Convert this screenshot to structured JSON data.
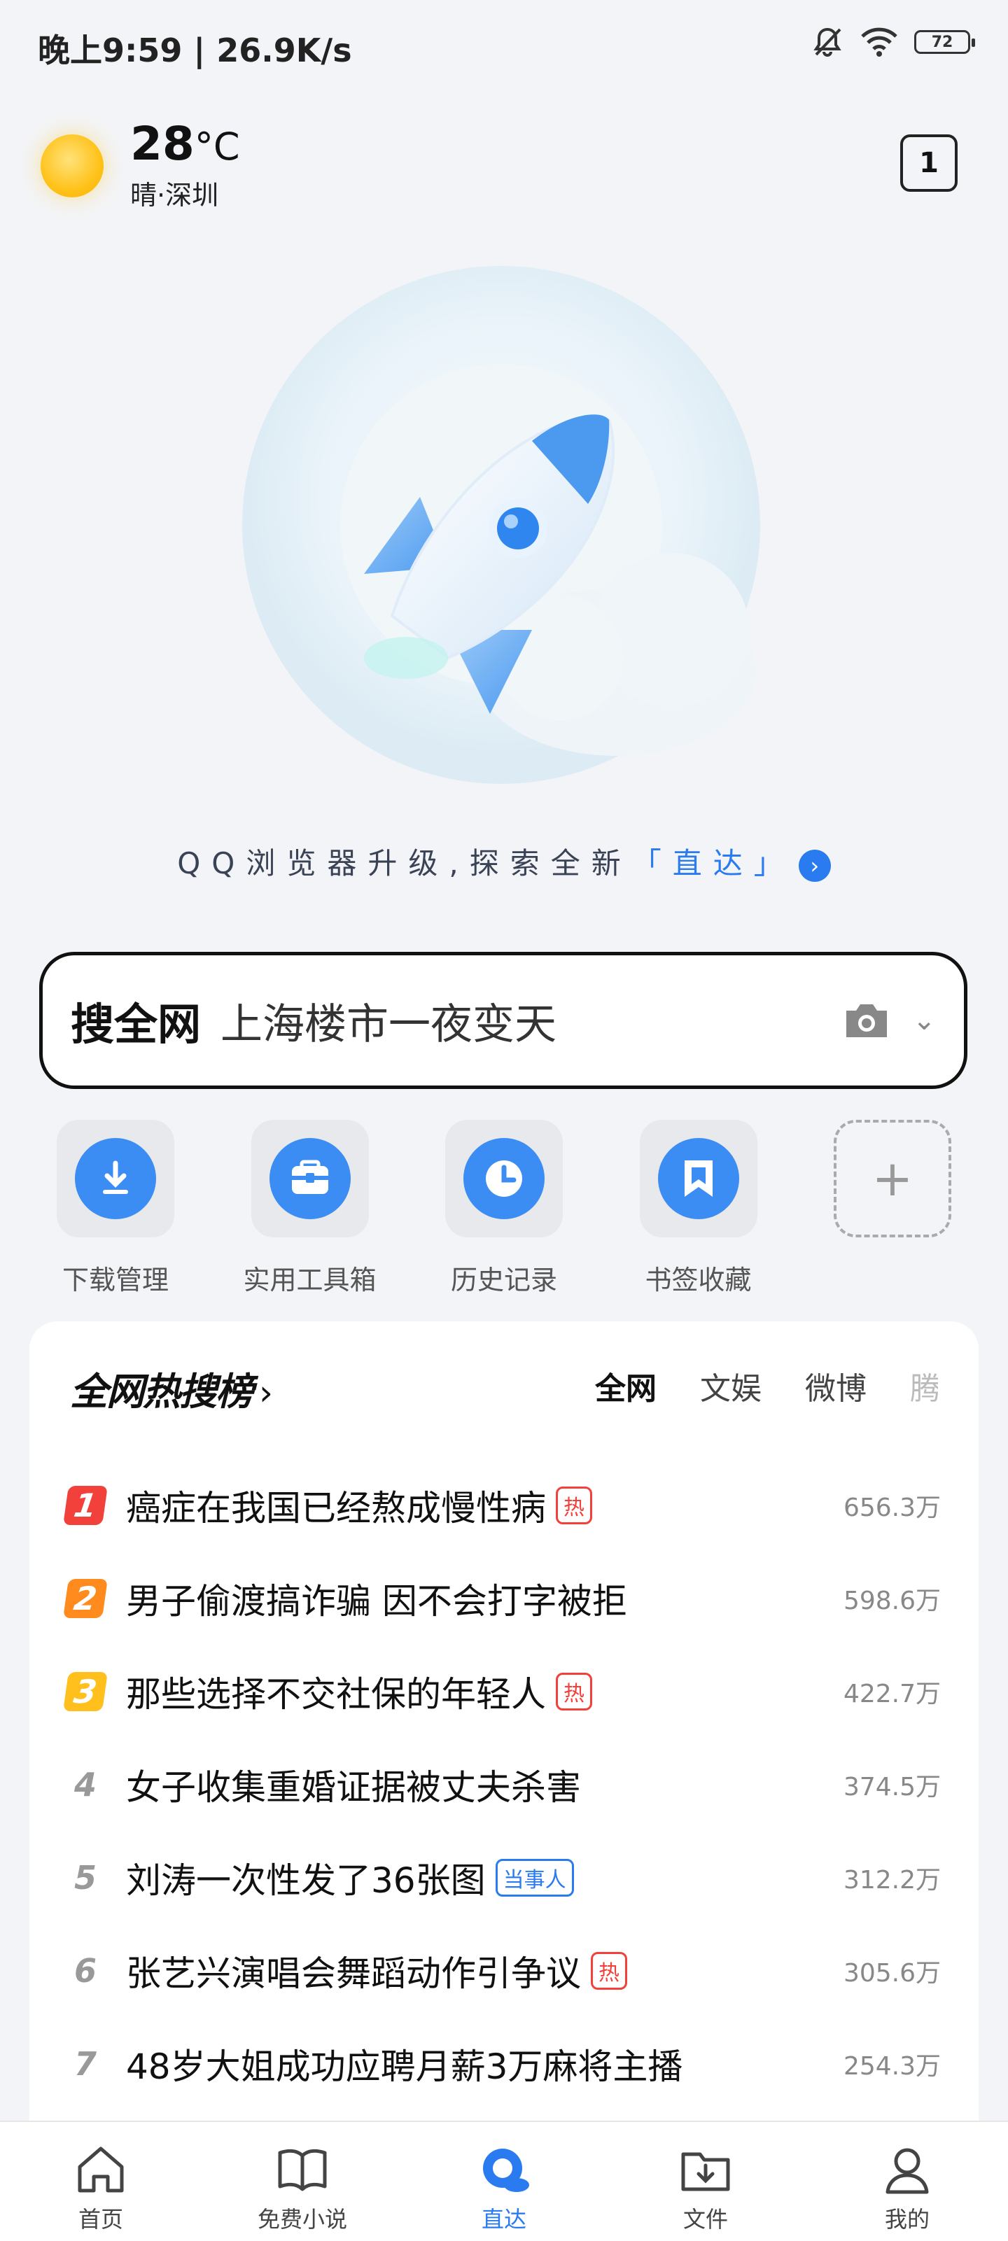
{
  "status_bar": {
    "time": "晚上9:59 | 26.9K/s",
    "battery": "72"
  },
  "weather": {
    "temperature": "28",
    "unit": "°C",
    "description": "晴·深圳"
  },
  "tab_count": "1",
  "upgrade_banner": {
    "prefix": "QQ浏览器升级,探索全新",
    "highlight": "「直达」"
  },
  "search": {
    "label": "搜全网",
    "query": "上海楼市一夜变天"
  },
  "shortcuts": [
    {
      "label": "下载管理",
      "icon": "download-icon"
    },
    {
      "label": "实用工具箱",
      "icon": "toolbox-icon"
    },
    {
      "label": "历史记录",
      "icon": "clock-icon"
    },
    {
      "label": "书签收藏",
      "icon": "bookmark-icon"
    },
    {
      "label": "",
      "icon": "plus-icon"
    }
  ],
  "hot_list": {
    "title": "全网热搜榜",
    "tabs": [
      "全网",
      "文娱",
      "微博",
      "腾"
    ],
    "items": [
      {
        "rank": "1",
        "title": "癌症在我国已经熬成慢性病",
        "tag": "热",
        "count": "656.3万"
      },
      {
        "rank": "2",
        "title": "男子偷渡搞诈骗 因不会打字被拒",
        "tag": "",
        "count": "598.6万"
      },
      {
        "rank": "3",
        "title": "那些选择不交社保的年轻人",
        "tag": "热",
        "count": "422.7万"
      },
      {
        "rank": "4",
        "title": "女子收集重婚证据被丈夫杀害",
        "tag": "",
        "count": "374.5万"
      },
      {
        "rank": "5",
        "title": "刘涛一次性发了36张图",
        "tag": "当事人",
        "count": "312.2万"
      },
      {
        "rank": "6",
        "title": "张艺兴演唱会舞蹈动作引争议",
        "tag": "热",
        "count": "305.6万"
      },
      {
        "rank": "7",
        "title": "48岁大姐成功应聘月薪3万麻将主播",
        "tag": "",
        "count": "254.3万"
      }
    ]
  },
  "bottom_nav": [
    {
      "label": "首页",
      "icon": "home-icon"
    },
    {
      "label": "免费小说",
      "icon": "book-icon"
    },
    {
      "label": "直达",
      "icon": "qq-browser-icon"
    },
    {
      "label": "文件",
      "icon": "file-download-icon"
    },
    {
      "label": "我的",
      "icon": "user-icon"
    }
  ],
  "colors": {
    "accent": "#2a7bf0",
    "hot": "#f2403a"
  }
}
